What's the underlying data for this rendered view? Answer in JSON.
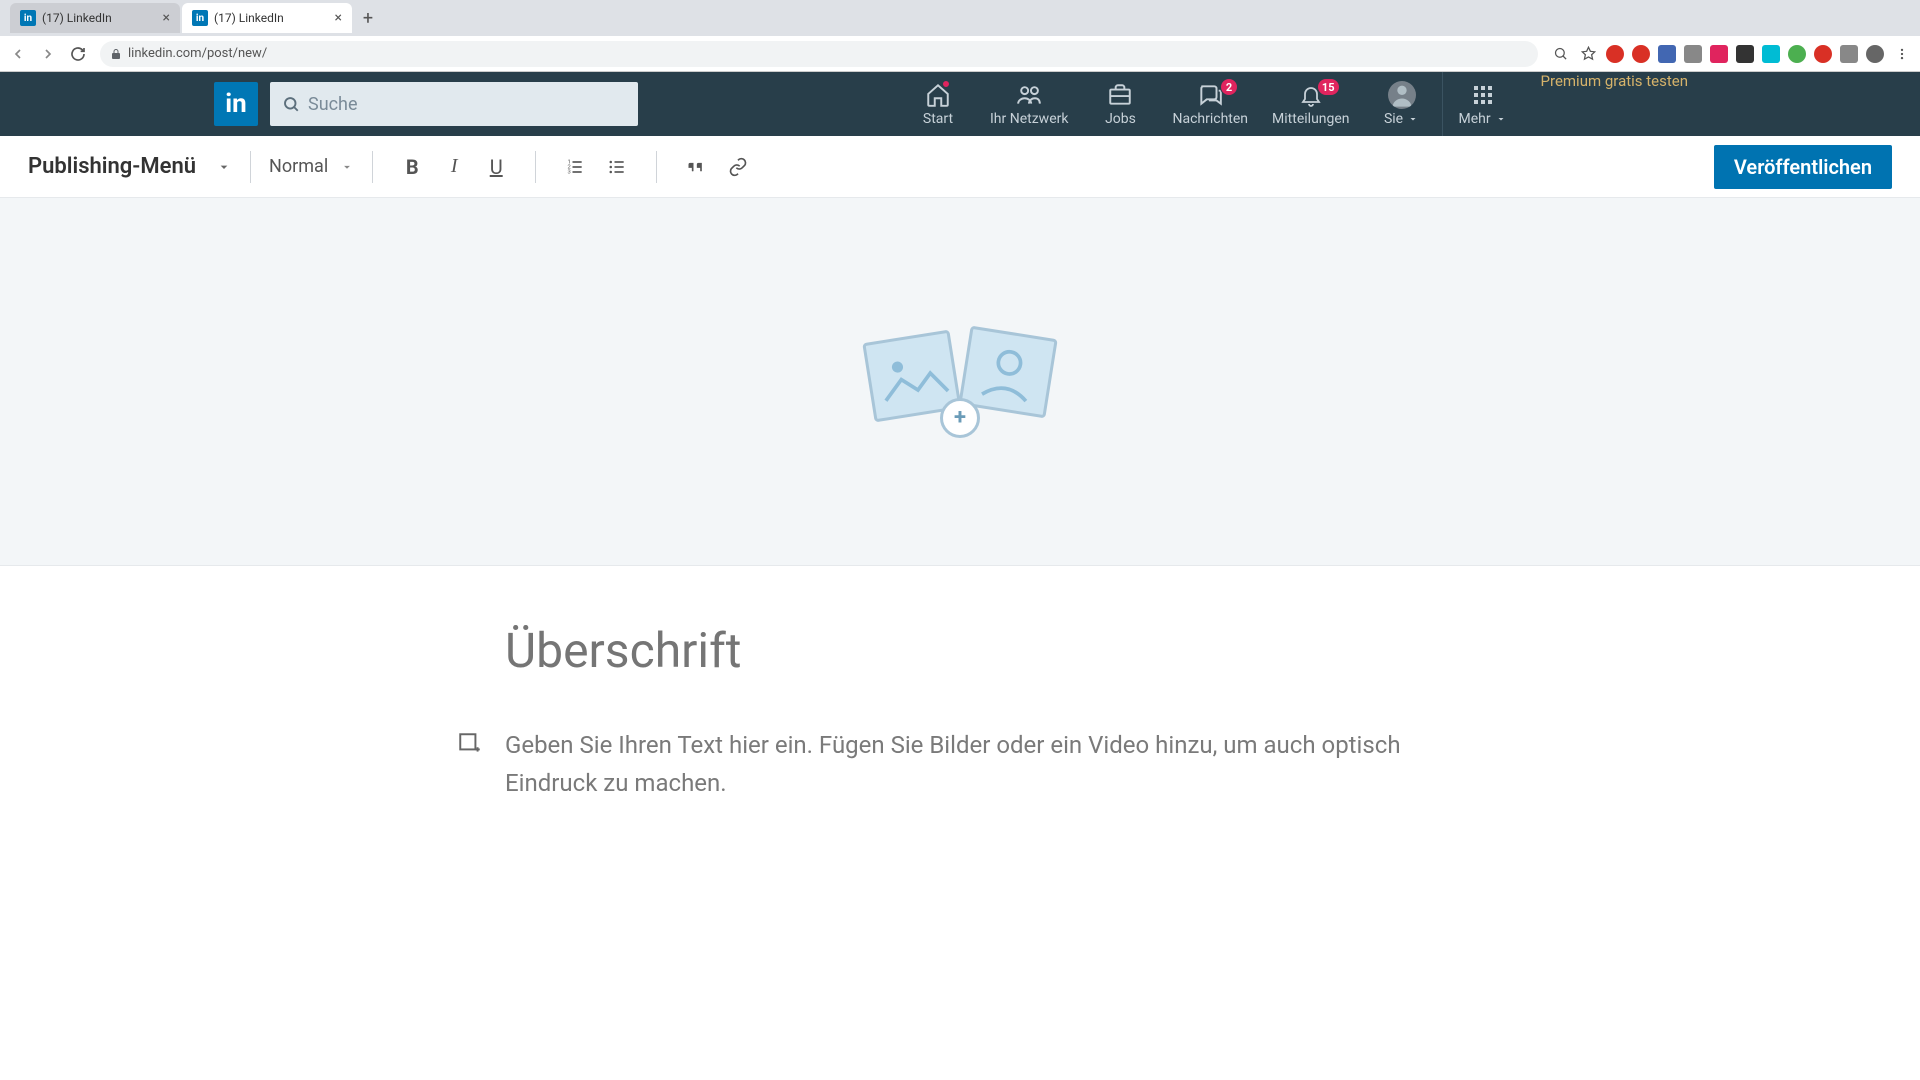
{
  "browser": {
    "tabs": [
      {
        "title": "(17) LinkedIn",
        "active": false
      },
      {
        "title": "(17) LinkedIn",
        "active": true
      }
    ],
    "url": "linkedin.com/post/new/"
  },
  "header": {
    "search_placeholder": "Suche",
    "nav": {
      "home": "Start",
      "network": "Ihr Netzwerk",
      "jobs": "Jobs",
      "messaging": "Nachrichten",
      "notifications": "Mitteilungen",
      "me": "Sie",
      "more": "Mehr"
    },
    "badges": {
      "messaging": "2",
      "notifications": "15"
    },
    "premium_cta": "Premium gratis testen"
  },
  "toolbar": {
    "publishing_menu": "Publishing-Menü",
    "style_select": "Normal",
    "publish_button": "Veröffentlichen"
  },
  "editor": {
    "title_placeholder": "Überschrift",
    "body_placeholder": "Geben Sie Ihren Text hier ein. Fügen Sie Bilder oder ein Video hinzu, um auch optisch Eindruck zu machen."
  },
  "colors": {
    "header_bg": "#283e4a",
    "accent": "#0073b1",
    "premium": "#d5b26a",
    "badge": "#e0245e"
  }
}
